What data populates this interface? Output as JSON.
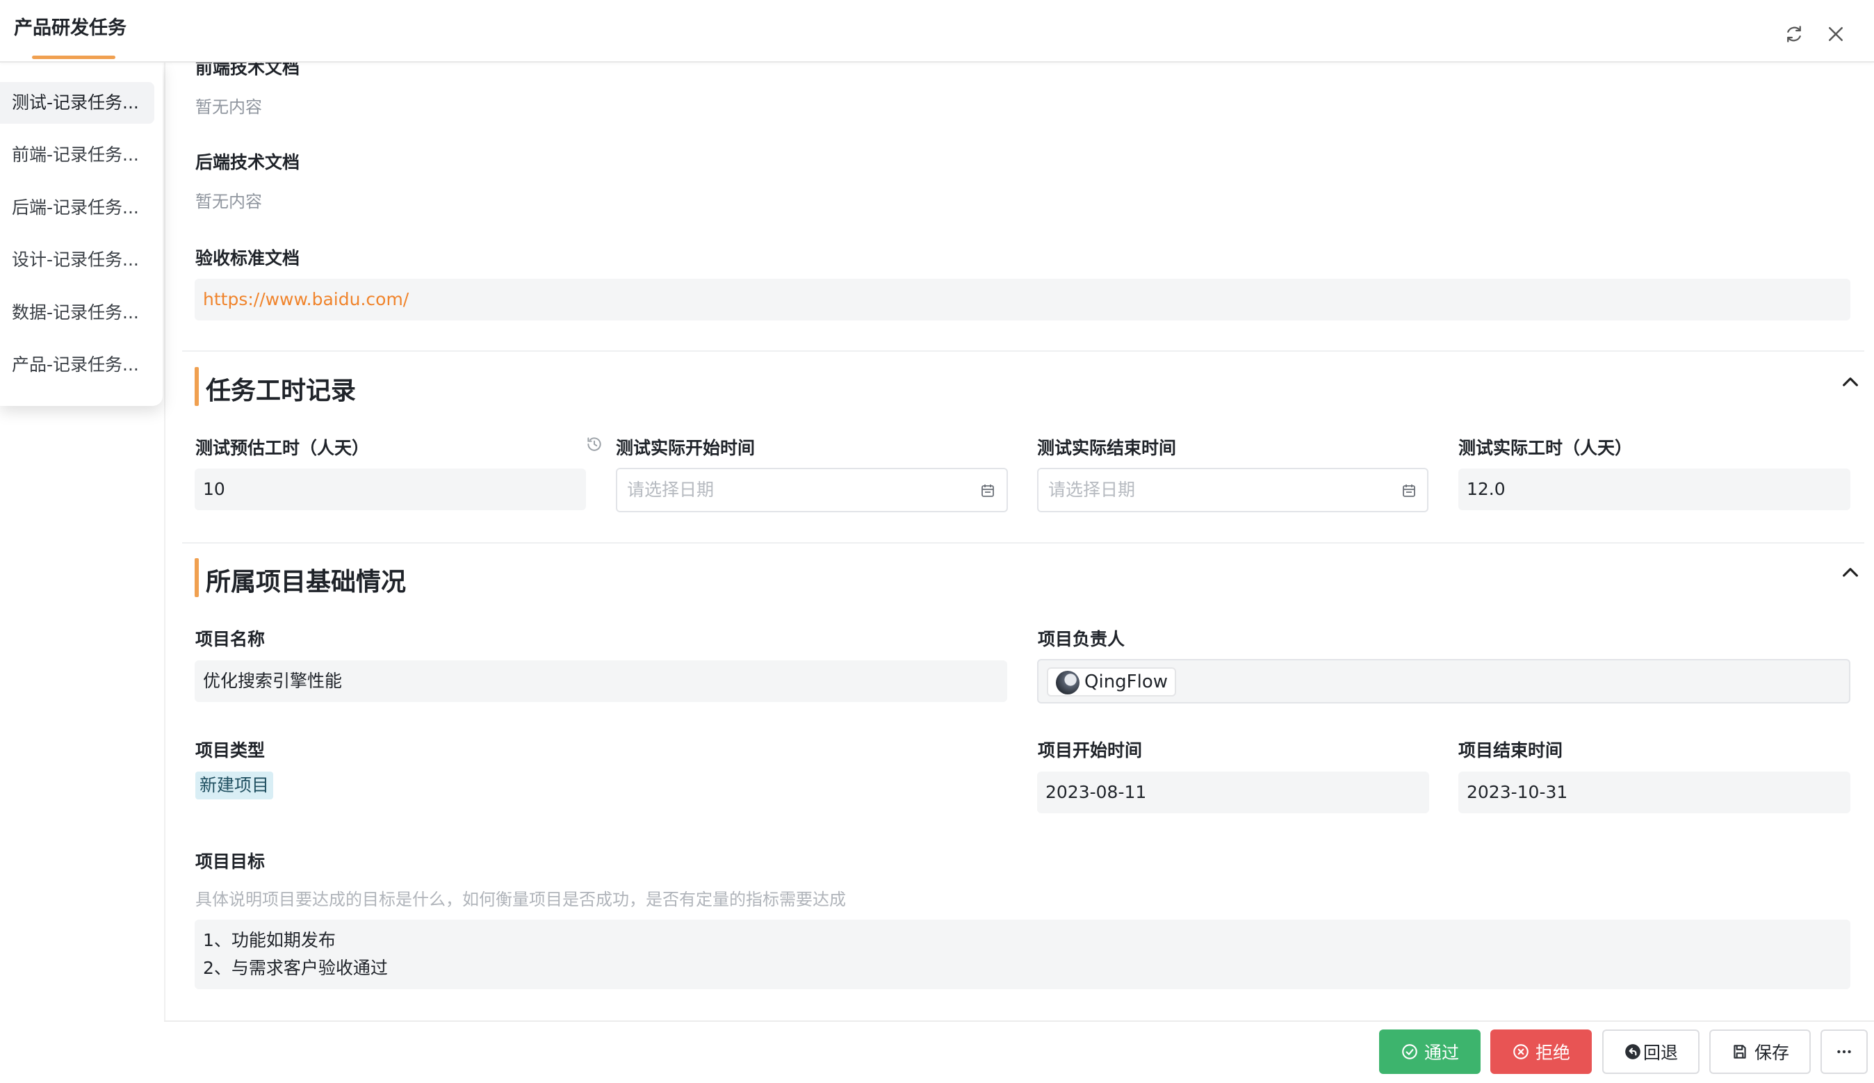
{
  "header": {
    "title": "产品研发任务",
    "refresh_icon": "refresh-icon",
    "close_icon": "close-icon"
  },
  "sidebar": {
    "items": [
      {
        "label": "测试-记录任务..."
      },
      {
        "label": "前端-记录任务..."
      },
      {
        "label": "后端-记录任务..."
      },
      {
        "label": "设计-记录任务..."
      },
      {
        "label": "数据-记录任务..."
      },
      {
        "label": "产品-记录任务..."
      }
    ]
  },
  "docs": {
    "frontend_label": "前端技术文档",
    "frontend_value": "暂无内容",
    "backend_label": "后端技术文档",
    "backend_value": "暂无内容",
    "acceptance_label": "验收标准文档",
    "acceptance_link": "https://www.baidu.com/"
  },
  "worktime": {
    "title": "任务工时记录",
    "estimate_label": "测试预估工时（人天）",
    "estimate_value": "10",
    "start_label": "测试实际开始时间",
    "start_placeholder": "请选择日期",
    "end_label": "测试实际结束时间",
    "end_placeholder": "请选择日期",
    "actual_label": "测试实际工时（人天）",
    "actual_value": "12.0"
  },
  "project": {
    "title": "所属项目基础情况",
    "name_label": "项目名称",
    "name_value": "优化搜索引擎性能",
    "owner_label": "项目负责人",
    "owner_value": "QingFlow",
    "type_label": "项目类型",
    "type_value": "新建项目",
    "start_label": "项目开始时间",
    "start_value": "2023-08-11",
    "end_label": "项目结束时间",
    "end_value": "2023-10-31",
    "goal_label": "项目目标",
    "goal_hint": "具体说明项目要达成的目标是什么，如何衡量项目是否成功，是否有定量的指标需要达成",
    "goal_lines": [
      "1、功能如期发布",
      "2、与需求客户验收通过"
    ]
  },
  "footer": {
    "approve_label": "通过",
    "reject_label": "拒绝",
    "rollback_label": "回退",
    "save_label": "保存",
    "colors": {
      "approve": "#3db46d",
      "reject": "#e85454",
      "accent": "#f0a050",
      "link": "#f0842c"
    }
  }
}
